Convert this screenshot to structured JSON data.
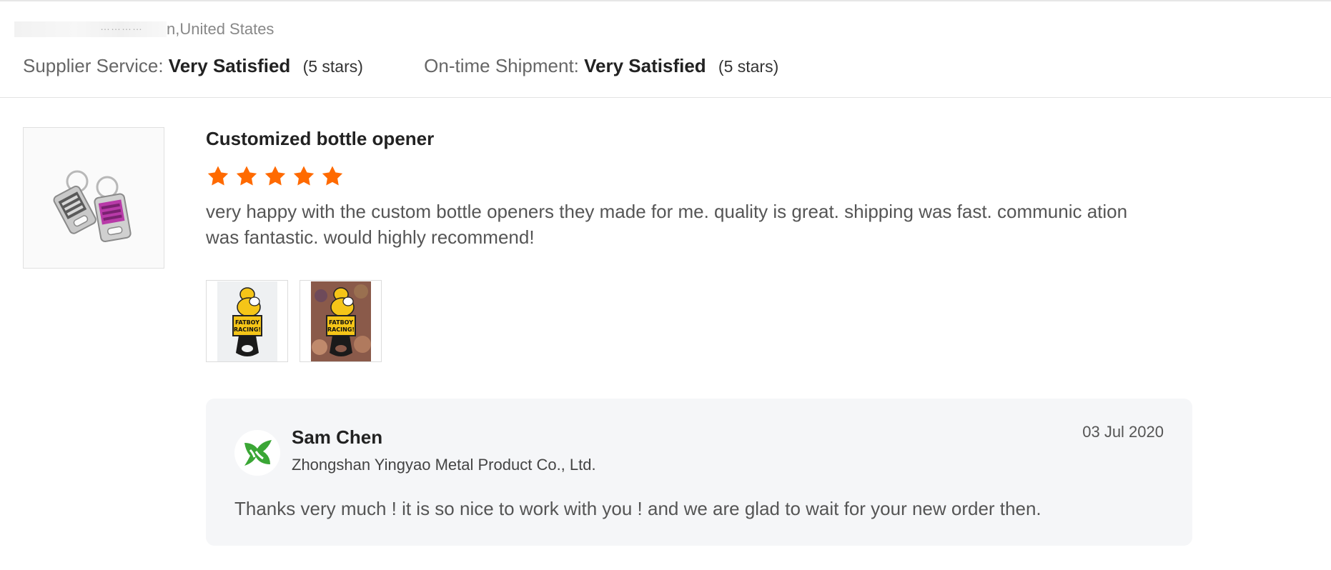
{
  "reviewer": {
    "location": "n,United States"
  },
  "ratings": [
    {
      "label": "Supplier Service:",
      "value": "Very Satisfied",
      "stars": "(5 stars)"
    },
    {
      "label": "On-time Shipment:",
      "value": "Very Satisfied",
      "stars": "(5 stars)"
    }
  ],
  "review": {
    "product_title": "Customized bottle opener",
    "rating": 5,
    "star_color": "#ff6a00",
    "text": "very happy with the custom bottle openers they made for me. quality is great. shipping was fast. communic ation was fantastic. would highly recommend!",
    "photos": [
      {
        "icon": "bottle-opener-photo",
        "printed_text": "FATBOY RACING!"
      },
      {
        "icon": "bottle-opener-in-hand-photo",
        "printed_text": "FATBOY RACING!"
      }
    ]
  },
  "reply": {
    "supplier_name": "Sam Chen",
    "company": "Zhongshan Yingyao Metal Product Co., Ltd.",
    "date": "03 Jul 2020",
    "text": "Thanks very much ! it is so nice to work with you ! and we are glad to wait for your new order then.",
    "logo_color": "#3aa635"
  }
}
